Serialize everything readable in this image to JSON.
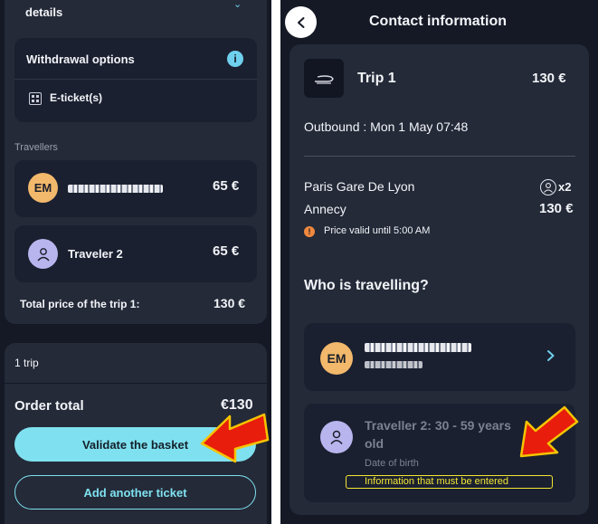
{
  "left": {
    "details_label": "details",
    "withdrawal_label": "Withdrawal options",
    "eticket_label": "E-ticket(s)",
    "travellers_heading": "Travellers",
    "travellers": [
      {
        "initials": "EM",
        "price": "65 €"
      },
      {
        "name": "Traveler 2",
        "price": "65 €"
      }
    ],
    "trip_total_label": "Total price of the trip 1:",
    "trip_total_value": "130 €",
    "trip_count": "1 trip",
    "order_total_label": "Order total",
    "order_total_value": "€130",
    "validate_label": "Validate the basket",
    "add_ticket_label": "Add another ticket"
  },
  "right": {
    "title": "Contact information",
    "trip_label": "Trip 1",
    "trip_price": "130 €",
    "outbound": "Outbound : Mon 1 May 07:48",
    "origin": "Paris Gare De Lyon",
    "destination": "Annecy",
    "passenger_count": "x2",
    "segment_price": "130 €",
    "price_valid": "Price valid until 5:00 AM",
    "who_heading": "Who is travelling?",
    "traveler1_initials": "EM",
    "traveller2_line1": "Traveller 2: 30 - 59 years",
    "traveller2_line2": "old",
    "dob_label": "Date of birth",
    "required_note": "Information that must be entered"
  },
  "colors": {
    "background": "#141925",
    "card": "#242a38",
    "accent": "#7fe1f0",
    "avatar_em": "#f2b86b",
    "avatar_traveler": "#b8b5ee",
    "info_blue": "#6fd0ee",
    "warning_orange": "#f0883e",
    "highlight_yellow": "#f3e633",
    "arrow_red": "#e81d0c"
  }
}
